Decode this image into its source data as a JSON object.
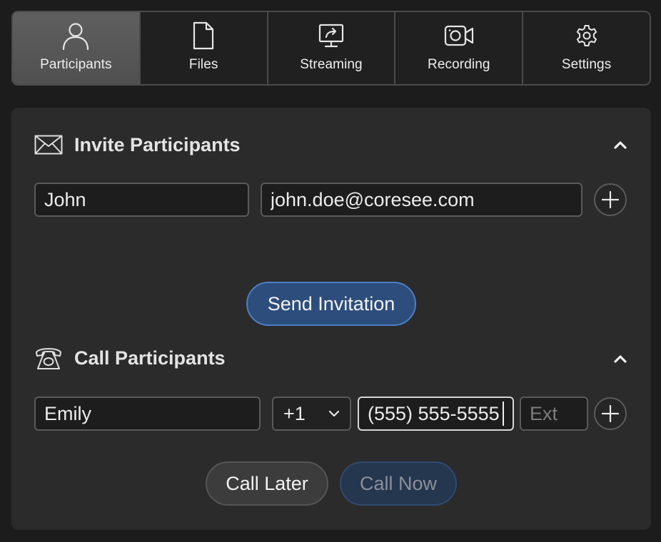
{
  "tabs": [
    {
      "label": "Participants",
      "icon": "person-icon",
      "active": true
    },
    {
      "label": "Files",
      "icon": "file-icon",
      "active": false
    },
    {
      "label": "Streaming",
      "icon": "screen-share-icon",
      "active": false
    },
    {
      "label": "Recording",
      "icon": "video-camera-icon",
      "active": false
    },
    {
      "label": "Settings",
      "icon": "gear-icon",
      "active": false
    }
  ],
  "invite": {
    "title": "Invite Participants",
    "icon": "envelope-icon",
    "name_value": "John",
    "email_value": "john.doe@coresee.com",
    "send_label": "Send Invitation"
  },
  "call": {
    "title": "Call Participants",
    "icon": "telephone-icon",
    "name_value": "Emily",
    "country_code": "+1",
    "phone_value": "(555) 555-5555",
    "ext_placeholder": "Ext",
    "call_later_label": "Call Later",
    "call_now_label": "Call Now"
  },
  "colors": {
    "background": "#1c1c1c",
    "panel": "#2b2b2b",
    "active_tab": "#575757",
    "primary_button": "#2d4e7c",
    "primary_border": "#4c7fc4"
  }
}
